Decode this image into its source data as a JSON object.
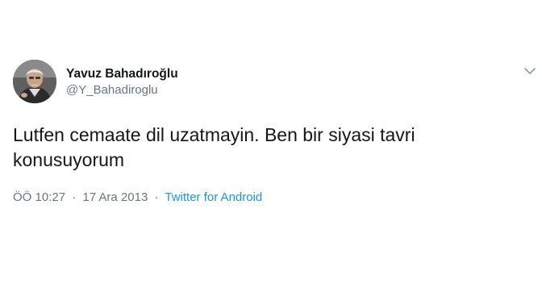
{
  "tweet": {
    "author_name": "Yavuz Bahadıroğlu",
    "author_handle": "@Y_Bahadiroglu",
    "text_line1": "Lutfen cemaate dil uzatmayin. Ben bir siyasi tavri",
    "text_line2": "konusuyorum",
    "time": "ÖÖ 10:27",
    "separator": "·",
    "date": "17 Ara 2013",
    "source": "Twitter for Android"
  },
  "icons": {
    "avatar": "profile-photo",
    "menu": "chevron-down-icon"
  },
  "colors": {
    "text": "#14171a",
    "secondary": "#657786",
    "link": "#1b95e0"
  }
}
